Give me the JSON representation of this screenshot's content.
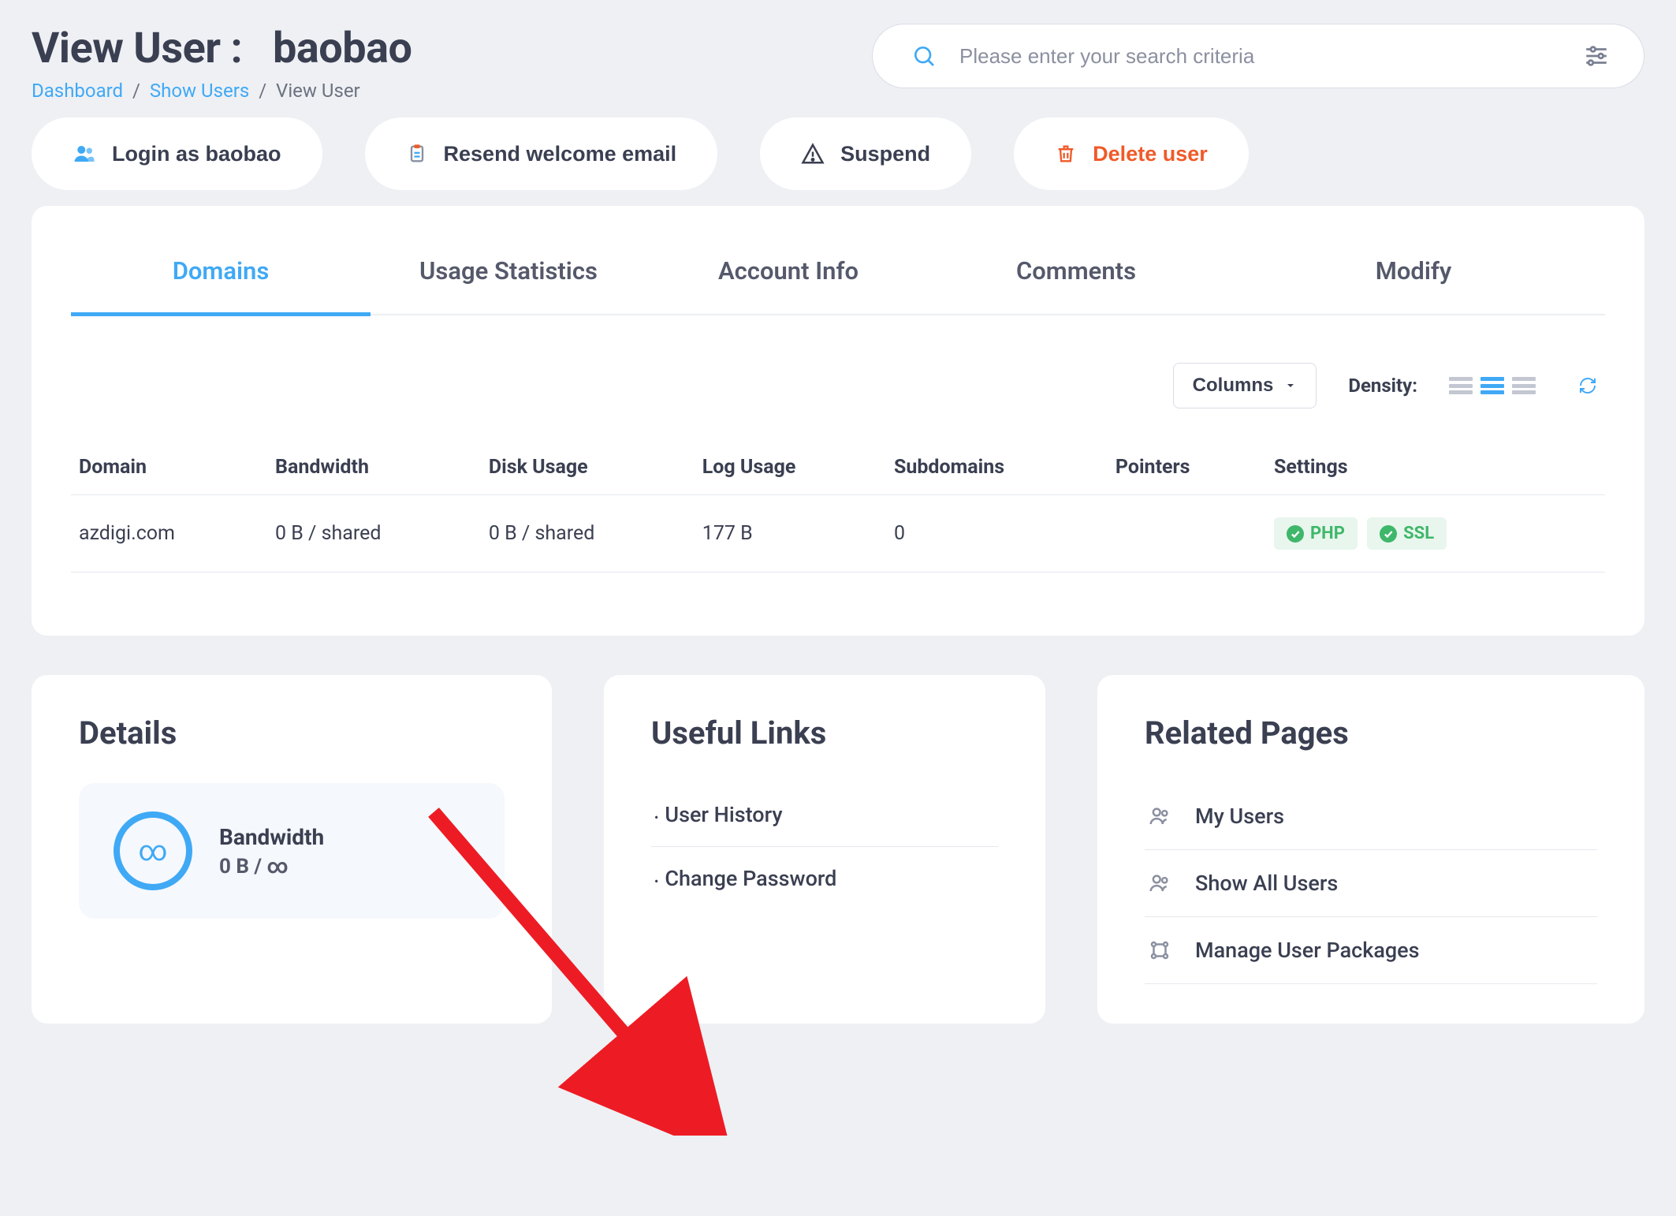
{
  "page_title_prefix": "View User :",
  "page_title_user": "baobao",
  "breadcrumb": {
    "dashboard": "Dashboard",
    "show_users": "Show Users",
    "current": "View User"
  },
  "search": {
    "placeholder": "Please enter your search criteria"
  },
  "actions": {
    "login_as": "Login as baobao",
    "resend": "Resend welcome email",
    "suspend": "Suspend",
    "delete": "Delete user"
  },
  "tabs": {
    "domains": "Domains",
    "usage": "Usage Statistics",
    "account": "Account Info",
    "comments": "Comments",
    "modify": "Modify"
  },
  "table": {
    "columns_btn": "Columns",
    "density_label": "Density:",
    "headers": {
      "domain": "Domain",
      "bandwidth": "Bandwidth",
      "disk": "Disk Usage",
      "log": "Log Usage",
      "sub": "Subdomains",
      "pointers": "Pointers",
      "settings": "Settings"
    },
    "rows": [
      {
        "domain": "azdigi.com",
        "bandwidth": "0 B / shared",
        "disk": "0 B / shared",
        "log": "177 B",
        "sub": "0",
        "pointers": "",
        "badge_php": "PHP",
        "badge_ssl": "SSL"
      }
    ]
  },
  "details": {
    "title": "Details",
    "bandwidth_label": "Bandwidth",
    "bandwidth_value": "0 B / ∞"
  },
  "useful": {
    "title": "Useful Links",
    "items": [
      "User History",
      "Change Password"
    ]
  },
  "related": {
    "title": "Related Pages",
    "items": [
      "My Users",
      "Show All Users",
      "Manage User Packages"
    ]
  }
}
